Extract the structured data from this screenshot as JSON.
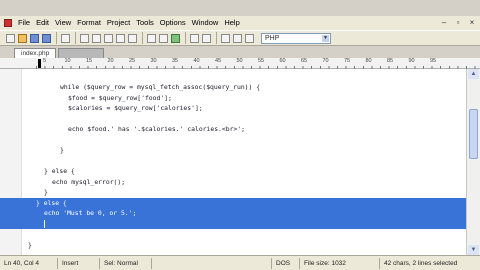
{
  "menu": {
    "items": [
      "File",
      "Edit",
      "View",
      "Format",
      "Project",
      "Tools",
      "Options",
      "Window",
      "Help"
    ]
  },
  "toolbar": {
    "language": "PHP"
  },
  "tabs": [
    {
      "label": "index.php"
    },
    {
      "label": ""
    }
  ],
  "ruler": {
    "numbers": [
      "5",
      "10",
      "15",
      "20",
      "25",
      "30",
      "35",
      "40",
      "45",
      "50",
      "55",
      "60",
      "65",
      "70",
      "75",
      "80",
      "85",
      "90",
      "95"
    ]
  },
  "editor": {
    "lines": [
      {
        "text": "while ($query_row = mysql_fetch_assoc($query_run)) {",
        "indent": 60
      },
      {
        "text": "$food = $query_row['food'];",
        "indent": 68
      },
      {
        "text": "$calories = $query_row['calories'];",
        "indent": 68
      },
      {
        "text": "",
        "indent": 0
      },
      {
        "text": "echo $food.' has '.$calories.' calories.<br>';",
        "indent": 68
      },
      {
        "text": "",
        "indent": 0
      },
      {
        "text": "}",
        "indent": 60
      },
      {
        "text": "",
        "indent": 0
      },
      {
        "text": "} else {",
        "indent": 44
      },
      {
        "text": "echo mysql_error();",
        "indent": 52
      },
      {
        "text": "}",
        "indent": 44
      },
      {
        "text": "} else {",
        "indent": 36,
        "selected": true
      },
      {
        "text": "echo 'Must be 0, or 5.';",
        "indent": 44,
        "selected": true
      },
      {
        "text": "",
        "indent": 0,
        "selected": true,
        "caret": 44
      },
      {
        "text": "",
        "indent": 0
      },
      {
        "text": "}",
        "indent": 28
      },
      {
        "text": "",
        "indent": 0
      }
    ]
  },
  "status": {
    "position": "Ln 40, Col 4",
    "mode": "Insert",
    "sel_mode": "Sel: Normal",
    "blank": "",
    "encoding": "DOS",
    "file_size": "File size: 1032",
    "selection": "42 chars, 2 lines selected"
  }
}
